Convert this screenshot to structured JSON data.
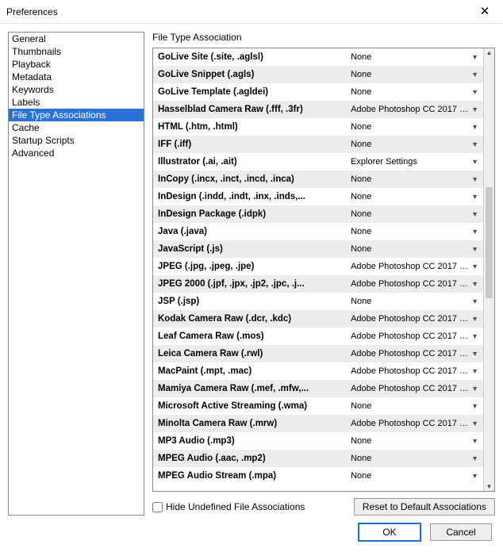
{
  "window": {
    "title": "Preferences"
  },
  "sidebar": {
    "items": [
      {
        "label": "General"
      },
      {
        "label": "Thumbnails"
      },
      {
        "label": "Playback"
      },
      {
        "label": "Metadata"
      },
      {
        "label": "Keywords"
      },
      {
        "label": "Labels"
      },
      {
        "label": "File Type Associations",
        "selected": true
      },
      {
        "label": "Cache"
      },
      {
        "label": "Startup Scripts"
      },
      {
        "label": "Advanced"
      }
    ]
  },
  "main": {
    "section_title": "File Type Association",
    "rows": [
      {
        "name": "GoLive Site (.site, .aglsl)",
        "value": "None"
      },
      {
        "name": "GoLive Snippet (.agls)",
        "value": "None"
      },
      {
        "name": "GoLive Template (.agldei)",
        "value": "None"
      },
      {
        "name": "Hasselblad Camera Raw (.fff, .3fr)",
        "value": "Adobe Photoshop CC 2017 1..."
      },
      {
        "name": "HTML (.htm, .html)",
        "value": "None"
      },
      {
        "name": "IFF (.iff)",
        "value": "None"
      },
      {
        "name": "Illustrator (.ai, .ait)",
        "value": "Explorer Settings"
      },
      {
        "name": "InCopy (.incx, .inct, .incd, .inca)",
        "value": "None"
      },
      {
        "name": "InDesign (.indd, .indt, .inx, .inds,...",
        "value": "None"
      },
      {
        "name": "InDesign Package (.idpk)",
        "value": "None"
      },
      {
        "name": "Java (.java)",
        "value": "None"
      },
      {
        "name": "JavaScript (.js)",
        "value": "None"
      },
      {
        "name": "JPEG (.jpg, .jpeg, .jpe)",
        "value": "Adobe Photoshop CC 2017 1..."
      },
      {
        "name": "JPEG 2000 (.jpf, .jpx, .jp2, .jpc, .j...",
        "value": "Adobe Photoshop CC 2017 1..."
      },
      {
        "name": "JSP (.jsp)",
        "value": "None"
      },
      {
        "name": "Kodak Camera Raw (.dcr, .kdc)",
        "value": "Adobe Photoshop CC 2017 1..."
      },
      {
        "name": "Leaf Camera Raw (.mos)",
        "value": "Adobe Photoshop CC 2017 1..."
      },
      {
        "name": "Leica Camera Raw (.rwl)",
        "value": "Adobe Photoshop CC 2017 1..."
      },
      {
        "name": "MacPaint (.mpt, .mac)",
        "value": "Adobe Photoshop CC 2017 1..."
      },
      {
        "name": "Mamiya Camera Raw (.mef, .mfw,...",
        "value": "Adobe Photoshop CC 2017 1..."
      },
      {
        "name": "Microsoft Active Streaming (.wma)",
        "value": "None"
      },
      {
        "name": "Minolta Camera Raw (.mrw)",
        "value": "Adobe Photoshop CC 2017 1..."
      },
      {
        "name": "MP3 Audio (.mp3)",
        "value": "None"
      },
      {
        "name": "MPEG Audio (.aac, .mp2)",
        "value": "None"
      },
      {
        "name": "MPEG Audio Stream (.mpa)",
        "value": "None"
      }
    ],
    "hide_undefined_label": "Hide Undefined File Associations",
    "reset_label": "Reset to Default Associations"
  },
  "footer": {
    "ok": "OK",
    "cancel": "Cancel"
  }
}
